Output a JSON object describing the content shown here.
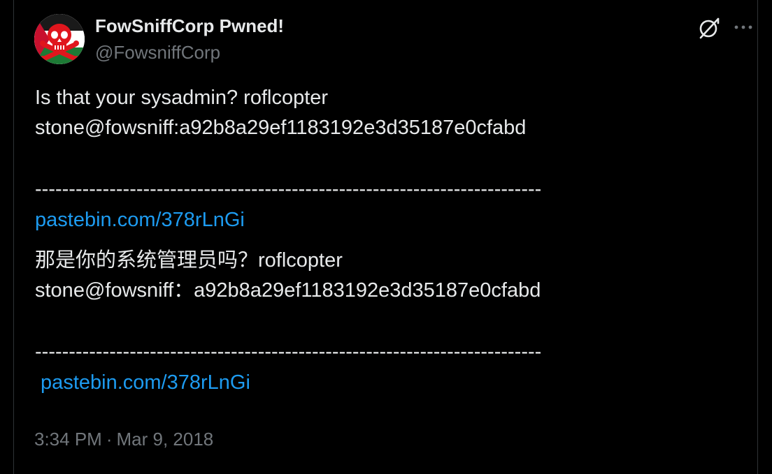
{
  "author": {
    "display_name": "FowSniffCorp Pwned!",
    "handle": "@FowsniffCorp",
    "avatar_icon": "skull-crossbones-icon"
  },
  "actions": {
    "grok_icon": "grok-slash-icon",
    "more_icon": "more-dots-icon"
  },
  "tweet": {
    "line1": "Is that your sysadmin? roflcopter",
    "line2": "stone@fowsniff:a92b8a29ef1183192e3d35187e0cfabd",
    "divider1": "---------------------------------------------------------------------------",
    "link1": "pastebin.com/378rLnGi",
    "line3": "那是你的系统管理员吗？roflcopter",
    "line4": "stone@fowsniff：a92b8a29ef1183192e3d35187e0cfabd",
    "divider2": "---------------------------------------------------------------------------",
    "link2": " pastebin.com/378rLnGi"
  },
  "meta": {
    "time": "3:34 PM",
    "separator": "·",
    "date": "Mar 9, 2018"
  },
  "colors": {
    "background": "#000000",
    "text": "#e7e9ea",
    "muted": "#71767b",
    "link": "#1d9bf0",
    "avatar_red": "#e0161d"
  }
}
